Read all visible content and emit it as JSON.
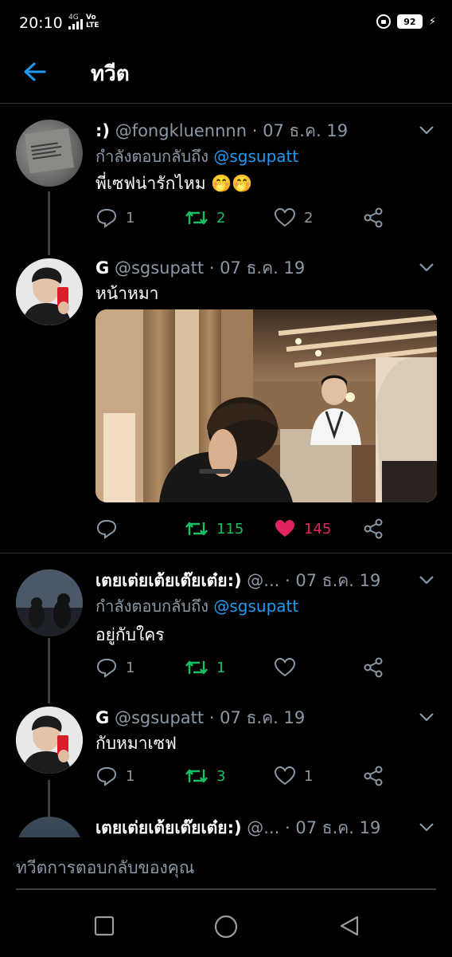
{
  "status_bar": {
    "time": "20:10",
    "network": "4G",
    "volte": "Vo LTE",
    "battery": "92"
  },
  "header": {
    "title": "ทวีต",
    "back_icon": "arrow-left-icon"
  },
  "tweets": [
    {
      "name": ":)",
      "handle": "@fongkluennnn",
      "date": "· 07 ธ.ค. 19",
      "reply_prefix": "กำลังตอบกลับถึง",
      "reply_mention": "@sgsupatt",
      "text": "พี่เซฟน่ารักไหม 🤭🤭",
      "replies": "1",
      "retweets": "2",
      "likes": "2"
    },
    {
      "name": "G",
      "handle": "@sgsupatt",
      "date": "· 07 ธ.ค. 19",
      "text": "หน้าหมา",
      "replies": "",
      "retweets": "115",
      "likes": "145"
    },
    {
      "name": "เตยเต่ยเต้ยเต๊ยเต๋ย:)",
      "handle": "@...",
      "date": "· 07 ธ.ค. 19",
      "reply_prefix": "กำลังตอบกลับถึง",
      "reply_mention": "@sgsupatt",
      "text": "อยู่กับใคร",
      "replies": "1",
      "retweets": "1",
      "likes": ""
    },
    {
      "name": "G",
      "handle": "@sgsupatt",
      "date": "· 07 ธ.ค. 19",
      "text": "กับหมาเซฟ",
      "replies": "1",
      "retweets": "3",
      "likes": "1"
    },
    {
      "name": "เตยเต่ยเต้ยเต๊ยเต๋ย:)",
      "handle": "@...",
      "date": "· 07 ธ.ค. 19"
    }
  ],
  "reply_bar": {
    "placeholder": "ทวีตการตอบกลับของคุณ"
  },
  "colors": {
    "background": "#000000",
    "accent": "#1d9bf0",
    "retweet": "#17bf63",
    "like": "#e0245e",
    "muted": "#8b98a5"
  }
}
